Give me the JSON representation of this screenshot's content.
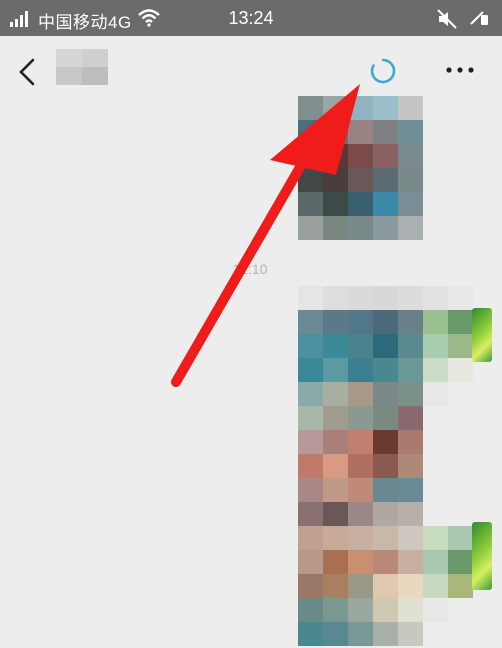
{
  "status_bar": {
    "carrier": "中国移动4G",
    "time": "13:24",
    "icons": [
      "signal-icon",
      "wifi-icon",
      "mute-icon",
      "battery-icon"
    ]
  },
  "header": {
    "contact_name": "",
    "icons": [
      "back-arrow-icon",
      "loading-spinner-icon",
      "more-icon"
    ]
  },
  "chat": {
    "timestamp": "12:10",
    "messages": [
      {
        "type": "image",
        "sender": "self",
        "content": "pixelated photo"
      },
      {
        "type": "image",
        "sender": "other",
        "content": "pixelated photo"
      }
    ]
  },
  "annotation": {
    "type": "red-arrow",
    "points_to": "loading-spinner-icon"
  },
  "colors": {
    "status_bar": "#6b6b6b",
    "background": "#ededed",
    "spinner": "#3aa8d8",
    "arrow": "#f01c1c"
  }
}
